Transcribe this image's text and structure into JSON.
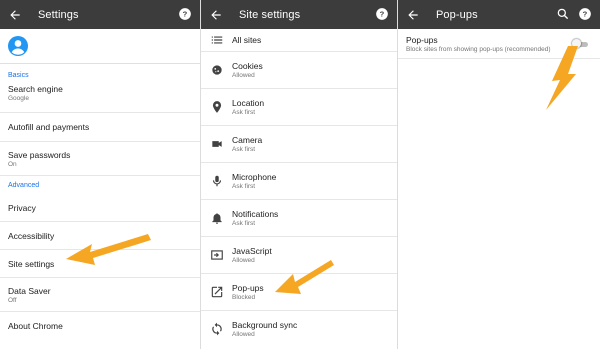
{
  "panel1": {
    "title": "Settings",
    "sections": [
      {
        "label": "Basics"
      },
      {
        "label": "Advanced"
      }
    ],
    "items": [
      {
        "title": "Search engine",
        "subtitle": "Google"
      },
      {
        "title": "Autofill and payments",
        "subtitle": ""
      },
      {
        "title": "Save passwords",
        "subtitle": "On"
      },
      {
        "title": "Privacy",
        "subtitle": ""
      },
      {
        "title": "Accessibility",
        "subtitle": ""
      },
      {
        "title": "Site settings",
        "subtitle": ""
      },
      {
        "title": "Data Saver",
        "subtitle": "Off"
      },
      {
        "title": "About Chrome",
        "subtitle": ""
      }
    ]
  },
  "panel2": {
    "title": "Site settings",
    "items": [
      {
        "title": "All sites",
        "subtitle": "",
        "icon": "list-icon"
      },
      {
        "title": "Cookies",
        "subtitle": "Allowed",
        "icon": "cookie-icon"
      },
      {
        "title": "Location",
        "subtitle": "Ask first",
        "icon": "location-pin-icon"
      },
      {
        "title": "Camera",
        "subtitle": "Ask first",
        "icon": "camera-icon"
      },
      {
        "title": "Microphone",
        "subtitle": "Ask first",
        "icon": "microphone-icon"
      },
      {
        "title": "Notifications",
        "subtitle": "Ask first",
        "icon": "bell-icon"
      },
      {
        "title": "JavaScript",
        "subtitle": "Allowed",
        "icon": "javascript-icon"
      },
      {
        "title": "Pop-ups",
        "subtitle": "Blocked",
        "icon": "open-in-new-icon"
      },
      {
        "title": "Background sync",
        "subtitle": "Allowed",
        "icon": "sync-icon"
      }
    ]
  },
  "panel3": {
    "title": "Pop-ups",
    "setting": {
      "title": "Pop-ups",
      "subtitle": "Block sites from showing pop-ups (recommended)",
      "enabled": false
    }
  },
  "colors": {
    "appbar": "#3c3c3c",
    "accent": "#1a73e8",
    "avatar": "#2196f3",
    "arrow": "#f5a623"
  }
}
